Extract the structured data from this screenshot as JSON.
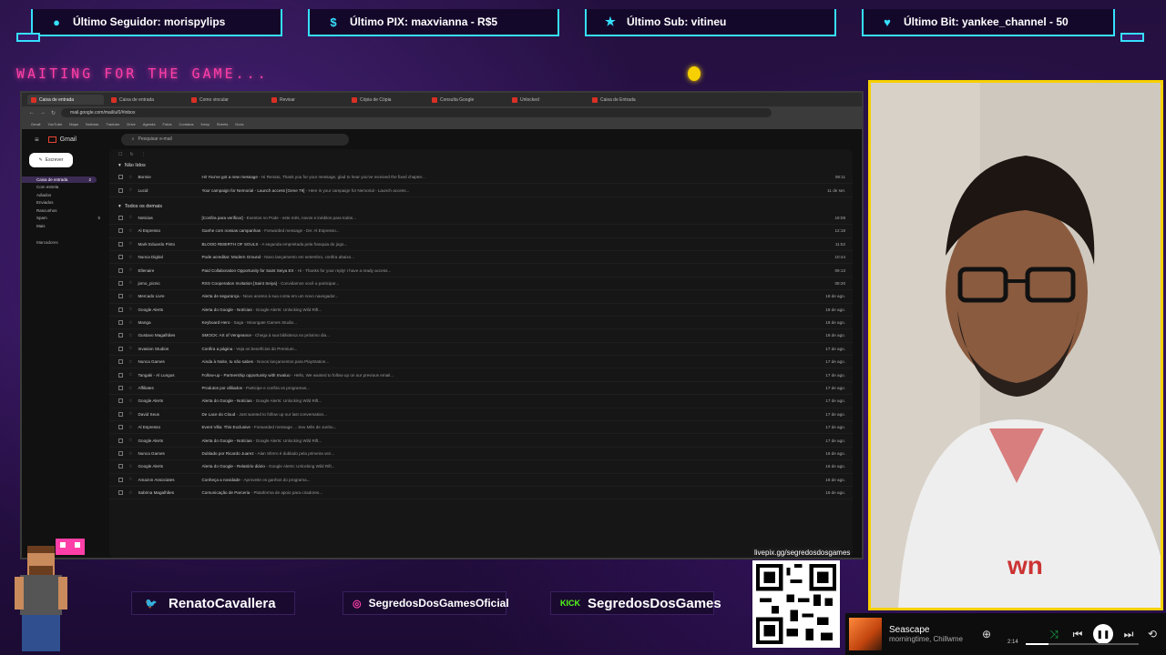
{
  "alerts": [
    {
      "icon": "user-icon",
      "text": "Último Seguidor: morispylips"
    },
    {
      "icon": "dollar-icon",
      "text": "Último PIX: maxvianna - R$5"
    },
    {
      "icon": "star-icon",
      "text": "Último Sub: vitineu"
    },
    {
      "icon": "heart-icon",
      "text": "Último Bit: yankee_channel - 50"
    }
  ],
  "waiting_text": "WAITING FOR THE GAME...",
  "browser": {
    "tabs": [
      "Caixa de entrada",
      "Caixa de entrada",
      "Como vincular",
      "Revisar",
      "Cópia de Cópia",
      "Consulta Google",
      "Unlocked",
      "Caixa de Entrada"
    ],
    "url": "mail.google.com/mail/u/0/#inbox",
    "bookmarks": [
      "Gmail",
      "YouTube",
      "Maps",
      "Notícias",
      "Tradutor",
      "Drive",
      "Agenda",
      "Fotos",
      "Contatos",
      "Keep",
      "Sheets",
      "Docs"
    ]
  },
  "gmail": {
    "logo": "Gmail",
    "search_placeholder": "Pesquisar e-mail",
    "compose": "Escrever",
    "nav": [
      {
        "label": "Caixa de entrada",
        "count": "2"
      },
      {
        "label": "Com estrela",
        "count": ""
      },
      {
        "label": "Adiados",
        "count": ""
      },
      {
        "label": "Enviados",
        "count": ""
      },
      {
        "label": "Rascunhos",
        "count": ""
      },
      {
        "label": "Spam",
        "count": "5"
      },
      {
        "label": "Mais",
        "count": ""
      }
    ],
    "labels_heading": "Marcadores",
    "unread_heading": "Não lidos",
    "all_heading": "Todos os demais",
    "unread": [
      {
        "sender": "Bonnie",
        "subject": "Hi! You've got a new message",
        "snippet": "Hi Renato, Thank you for your message, glad to hear you've received the fixed chapter...",
        "date": "08:11"
      },
      {
        "sender": "Lucid",
        "subject": "Your campaign for Nemorial - Launch access [Gene 79]",
        "snippet": "Here is your campaign for Nemorial - Launch access...",
        "date": "11 de set."
      }
    ],
    "others": [
      {
        "sender": "Noticias",
        "subject": "[Confira para verificar]",
        "snippet": "Eventos no Pode - este mês, novos e inéditos para todos...",
        "date": "18:08"
      },
      {
        "sender": "Al Espresso",
        "subject": "Ganhe com nossas campanhas",
        "snippet": "Forwarded message - De: Al Espresso...",
        "date": "12:18"
      },
      {
        "sender": "Mark Eduardo Pinto",
        "subject": "BLOOD REBIRTH OF SOULS",
        "snippet": "A segunda empreitada pela franquia do jogo...",
        "date": "11:52"
      },
      {
        "sender": "Nunca Digital",
        "subject": "Pode acreditar: Modern Ground",
        "snippet": "Novo lançamento em setembro, confira abaixo...",
        "date": "10:44"
      },
      {
        "sender": "Ellenaire",
        "subject": "Paid Collaboration Opportunity for Saint Seiya EX",
        "snippet": "Hi - Thanks for your reply! I have a ready access...",
        "date": "09:13"
      },
      {
        "sender": "jomo_picnic",
        "subject": "RSS Cooperation Invitation [Saint Seiya]",
        "snippet": "Convidamos você a participar...",
        "date": "08:20"
      },
      {
        "sender": "Mercado Livre",
        "subject": "Alerta de segurança",
        "snippet": "Novo acesso à sua conta em um novo navegador...",
        "date": "18 de ago."
      },
      {
        "sender": "Google Alerts",
        "subject": "Alerta do Google - Notícias",
        "snippet": "Google Alerts: Unlocking Wild Rift...",
        "date": "18 de ago."
      },
      {
        "sender": "Manga",
        "subject": "Keyboard Hero",
        "snippet": "Saga - Moongate Games Studio...",
        "date": "18 de ago."
      },
      {
        "sender": "Gustavo Magalhães",
        "subject": "SMOCK: Art of Vengeance",
        "snippet": "Chega à sua biblioteca no próximo dia...",
        "date": "18 de ago."
      },
      {
        "sender": "Invasion Studios",
        "subject": "Confira a página",
        "snippet": "Veja os benefícios do Premium...",
        "date": "17 de ago."
      },
      {
        "sender": "Nunca Games",
        "subject": "Ainda à Noite, tu não sabes",
        "snippet": "Novos lançamentos para PlayStation...",
        "date": "17 de ago."
      },
      {
        "sender": "Tangaki - Al Lungus",
        "subject": "Follow-up - Partnership opportunity with Invaluo",
        "snippet": "Hello, We wanted to follow up on our previous email...",
        "date": "17 de ago."
      },
      {
        "sender": "Affiliates",
        "subject": "Produtos por afiliados",
        "snippet": "Participe e confira os programas...",
        "date": "17 de ago."
      },
      {
        "sender": "Google Alerts",
        "subject": "Alerta do Google - Notícias",
        "snippet": "Google Alerts: Unlocking Wild Rift...",
        "date": "17 de ago."
      },
      {
        "sender": "David Seus",
        "subject": "De Lace do Cloud",
        "snippet": "Just wanted to follow up our last conversation...",
        "date": "17 de ago."
      },
      {
        "sender": "Al Espresso",
        "subject": "Event Villa: This Exclusive",
        "snippet": "Forwarded message ... Seu Mês de Junho...",
        "date": "17 de ago."
      },
      {
        "sender": "Google Alerts",
        "subject": "Alerta do Google - Notícias",
        "snippet": "Google Alerts: Unlocking Wild Rift...",
        "date": "17 de ago."
      },
      {
        "sender": "Nunca Games",
        "subject": "Dublado por Ricardo Juarez",
        "snippet": "Alan Sferro é dublado pela primeira vez...",
        "date": "16 de ago."
      },
      {
        "sender": "Google Alerts",
        "subject": "Alerta do Google - Relatório diário",
        "snippet": "Google Alerts: Unlocking Wild Rift...",
        "date": "16 de ago."
      },
      {
        "sender": "Amazon Associates",
        "subject": "Conheça a novidade",
        "snippet": "Aproveite os ganhos do programa...",
        "date": "16 de ago."
      },
      {
        "sender": "Sabrina Magalhães",
        "subject": "Comunicação de Parceria",
        "snippet": "Plataforma de apoio para criadores...",
        "date": "16 de ago."
      }
    ]
  },
  "social": [
    {
      "icon": "twitter-icon",
      "glyph": "🐦",
      "handle": "RenatoCavallera"
    },
    {
      "icon": "instagram-icon",
      "glyph": "◎",
      "handle": "SegredosDosGamesOficial"
    },
    {
      "icon": "kick-icon",
      "glyph": "KICK",
      "handle": "SegredosDosGames"
    }
  ],
  "qr_label": "livepix.gg/segredosdosgames",
  "player": {
    "track": "Seascape",
    "artist": "morningtime, Chillwme",
    "time": "2:14",
    "progress_fraction": 0.2
  },
  "colors": {
    "accent": "#35e0ff",
    "waiting": "#ff3fa7",
    "cam_border": "#f6d000"
  }
}
